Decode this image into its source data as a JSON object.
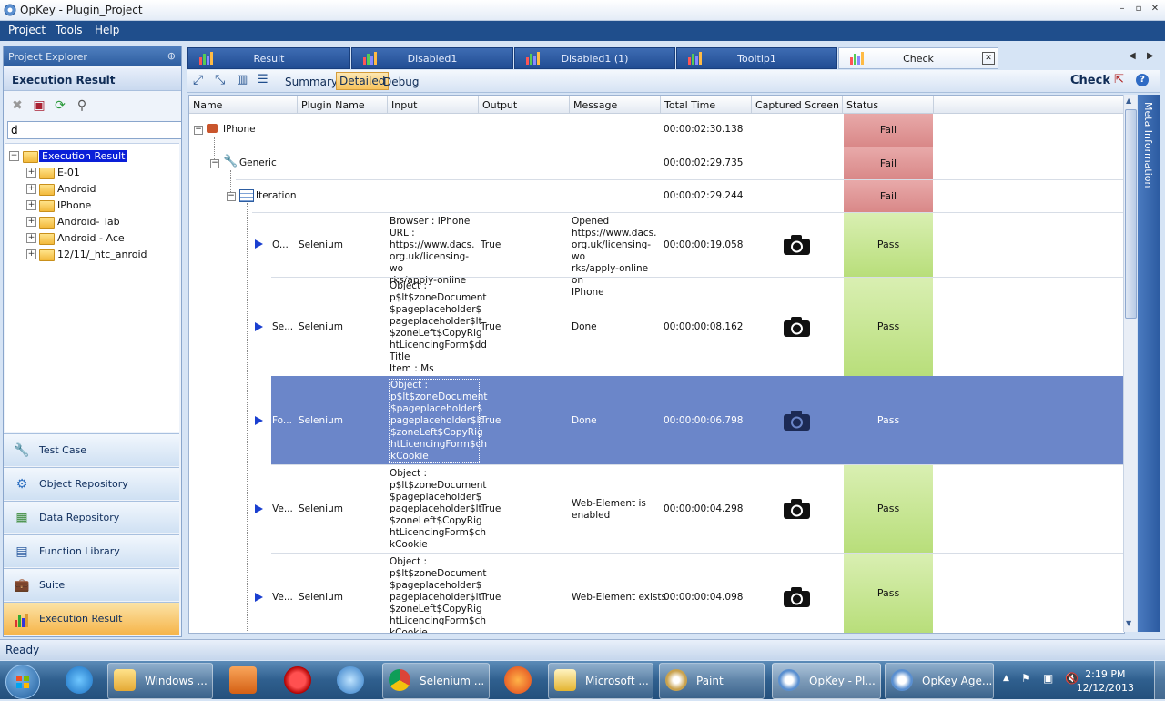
{
  "window": {
    "title": "OpKey - Plugin_Project",
    "min": "–",
    "max": "▫",
    "close": "✕"
  },
  "menu": [
    "Project",
    "Tools",
    "Help"
  ],
  "left_panel": {
    "title": "Project Explorer",
    "pin": "⊕",
    "header": "Execution Result",
    "search_value": "d",
    "tree": [
      {
        "label": "Execution Result",
        "selected": true,
        "level": 0
      },
      {
        "label": "E-01",
        "level": 1
      },
      {
        "label": "Android",
        "level": 1
      },
      {
        "label": "IPhone",
        "level": 1
      },
      {
        "label": "Android- Tab",
        "level": 1
      },
      {
        "label": "Android - Ace",
        "level": 1
      },
      {
        "label": "12/11/_htc_anroid",
        "level": 1
      }
    ],
    "nav": [
      "Test Case",
      "Object Repository",
      "Data Repository",
      "Function Library",
      "Suite",
      "Execution Result"
    ]
  },
  "tabs": [
    "Result",
    "Disabled1",
    "Disabled1 (1)",
    "Tooltip1",
    "Check"
  ],
  "tab_close": "✕",
  "view_buttons": [
    "Summary",
    "Detailed",
    "Debug"
  ],
  "toolbar_right_title": "Check",
  "grid": {
    "columns": [
      "Name",
      "Plugin Name",
      "Input",
      "Output",
      "Message",
      "Total Time",
      "Captured Screen",
      "Status"
    ],
    "groups": [
      {
        "name": "IPhone",
        "time": "00:00:02:30.138",
        "status": "Fail"
      },
      {
        "name": "Generic",
        "time": "00:00:02:29.735",
        "status": "Fail"
      },
      {
        "name": "Iteration",
        "time": "00:00:02:29.244",
        "status": "Fail"
      }
    ],
    "steps": [
      {
        "name": "O...",
        "plugin": "Selenium",
        "input": [
          "Browser : IPhone",
          "URL :",
          "https://www.dacs.",
          "org.uk/licensing-wo",
          "rks/apply-online"
        ],
        "output": "True",
        "message": [
          "Opened",
          "https://www.dacs.",
          "org.uk/licensing-wo",
          "rks/apply-online on",
          "IPhone"
        ],
        "time": "00:00:00:19.058",
        "status": "Pass"
      },
      {
        "name": "Se...",
        "plugin": "Selenium",
        "input": [
          "Object :",
          "p$lt$zoneDocument",
          "$pageplaceholder$",
          "pageplaceholder$lt",
          "$zoneLeft$CopyRig",
          "htLicencingForm$dd",
          "Title",
          "Item : Ms"
        ],
        "output": "True",
        "message": [
          "Done"
        ],
        "time": "00:00:00:08.162",
        "status": "Pass"
      },
      {
        "name": "Fo...",
        "plugin": "Selenium",
        "input": [
          "Object :",
          "p$lt$zoneDocument",
          "$pageplaceholder$",
          "pageplaceholder$lt",
          "$zoneLeft$CopyRig",
          "htLicencingForm$ch",
          "kCookie"
        ],
        "output": "True",
        "message": [
          "Done"
        ],
        "time": "00:00:00:06.798",
        "status": "Pass",
        "selected": true
      },
      {
        "name": "Ve...",
        "plugin": "Selenium",
        "input": [
          "Object :",
          "p$lt$zoneDocument",
          "$pageplaceholder$",
          "pageplaceholder$lt",
          "$zoneLeft$CopyRig",
          "htLicencingForm$ch",
          "kCookie"
        ],
        "output": "True",
        "message": [
          "Web-Element is",
          "enabled"
        ],
        "time": "00:00:00:04.298",
        "status": "Pass"
      },
      {
        "name": "Ve...",
        "plugin": "Selenium",
        "input": [
          "Object :",
          "p$lt$zoneDocument",
          "$pageplaceholder$",
          "pageplaceholder$lt",
          "$zoneLeft$CopyRig",
          "htLicencingForm$ch",
          "kCookie"
        ],
        "output": "True",
        "message": [
          "Web-Element exists"
        ],
        "time": "00:00:00:04.098",
        "status": "Pass"
      }
    ]
  },
  "right_sidebar": "Meta Information",
  "status_bar": "Ready",
  "taskbar": {
    "items": [
      "Windows ...",
      "Selenium ...",
      "Microsoft ...",
      "Paint",
      "OpKey - Pl...",
      "OpKey Age..."
    ],
    "time": "2:19 PM",
    "date": "12/12/2013"
  },
  "colors": {
    "fail": "#d98888",
    "pass": "#b8de7a",
    "selected_row": "#6b86c9",
    "menu_bg": "#1f4e8c"
  }
}
